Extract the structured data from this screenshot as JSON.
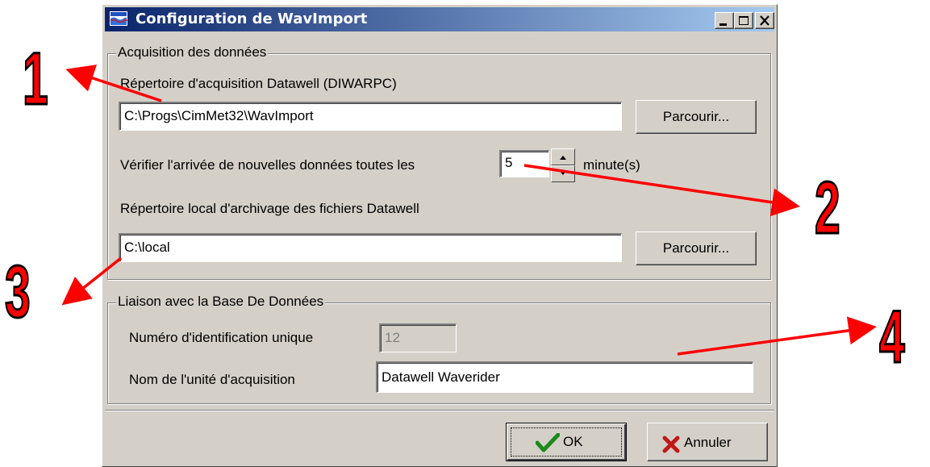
{
  "window": {
    "title": "Configuration de WavImport",
    "controls": [
      "minimize",
      "maximize",
      "close"
    ]
  },
  "acquisition": {
    "group_title": "Acquisition des données",
    "dir_label": "Répertoire d'acquisition Datawell (DIWARPC)",
    "dir_value": "C:\\Progs\\CimMet32\\WavImport",
    "browse_label_1": "Parcourir...",
    "check_label": "Vérifier l'arrivée de nouvelles données toutes les",
    "interval_value": "5",
    "interval_unit": "minute(s)",
    "archive_label": "Répertoire local d'archivage des fichiers Datawell",
    "archive_value": "C:\\local",
    "browse_label_2": "Parcourir..."
  },
  "database": {
    "group_title": "Liaison avec la Base De Données",
    "id_label": "Numéro d'identification unique",
    "id_value": "12",
    "unit_label": "Nom de l'unité d'acquisition",
    "unit_value": "Datawell Waverider"
  },
  "buttons": {
    "ok_label": "OK",
    "cancel_label": "Annuler"
  },
  "callouts": [
    "1",
    "2",
    "3",
    "4"
  ],
  "colors": {
    "callout": "#ff0000",
    "titlebar_start": "#0a246a",
    "titlebar_end": "#a6caf0",
    "dialog_bg": "#d4d0c8"
  }
}
